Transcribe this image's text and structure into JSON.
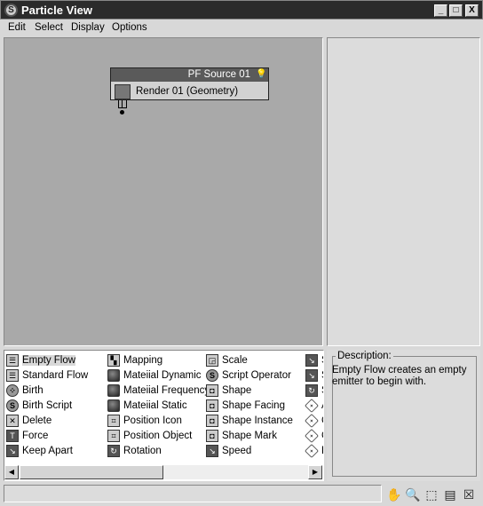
{
  "window": {
    "title": "Particle View",
    "min": "_",
    "max": "□",
    "close": "X"
  },
  "menu": [
    "Edit",
    "Select",
    "Display",
    "Options"
  ],
  "node": {
    "title": "PF Source 01",
    "operator": "Render 01 (Geometry)"
  },
  "depot": {
    "columns": [
      [
        {
          "label": "Empty Flow",
          "icon": "flow-icon",
          "selected": true
        },
        {
          "label": "Standard Flow",
          "icon": "flow-icon"
        },
        {
          "label": "Birth",
          "icon": "birth-icon"
        },
        {
          "label": "Birth Script",
          "icon": "script-icon"
        },
        {
          "label": "Delete",
          "icon": "delete-icon"
        },
        {
          "label": "Force",
          "icon": "force-icon"
        },
        {
          "label": "Keep Apart",
          "icon": "speed-icon"
        }
      ],
      [
        {
          "label": "Mapping",
          "icon": "mapping-icon"
        },
        {
          "label": "Mateiial Dynamic",
          "icon": "material-icon"
        },
        {
          "label": "Mateiial Frequency",
          "icon": "material-icon"
        },
        {
          "label": "Mateiial Static",
          "icon": "material-icon"
        },
        {
          "label": "Position Icon",
          "icon": "position-icon"
        },
        {
          "label": "Position Object",
          "icon": "position-icon"
        },
        {
          "label": "Rotation",
          "icon": "rotation-icon"
        }
      ],
      [
        {
          "label": "Scale",
          "icon": "scale-icon"
        },
        {
          "label": "Script Operator",
          "icon": "script-icon"
        },
        {
          "label": "Shape",
          "icon": "shape-icon"
        },
        {
          "label": "Shape Facing",
          "icon": "shape-icon"
        },
        {
          "label": "Shape Instance",
          "icon": "shape-icon"
        },
        {
          "label": "Shape Mark",
          "icon": "shape-icon"
        },
        {
          "label": "Speed",
          "icon": "speed-icon"
        }
      ],
      [
        {
          "label": "S",
          "icon": "speed-icon"
        },
        {
          "label": "S",
          "icon": "speed-icon"
        },
        {
          "label": "S",
          "icon": "rotation-icon"
        },
        {
          "label": "A",
          "icon": "test-icon"
        },
        {
          "label": "C",
          "icon": "test-icon"
        },
        {
          "label": "C",
          "icon": "test-icon"
        },
        {
          "label": "F",
          "icon": "test-icon"
        }
      ]
    ]
  },
  "description": {
    "label": "Description:",
    "text": "Empty Flow creates an empty emitter to begin with."
  },
  "tools": [
    {
      "name": "pan-icon",
      "glyph": "✋"
    },
    {
      "name": "zoom-icon",
      "glyph": "🔍"
    },
    {
      "name": "zoom-region-icon",
      "glyph": "⬚"
    },
    {
      "name": "zoom-extents-icon",
      "glyph": "▤"
    },
    {
      "name": "no-zoom-icon",
      "glyph": "☒"
    }
  ]
}
